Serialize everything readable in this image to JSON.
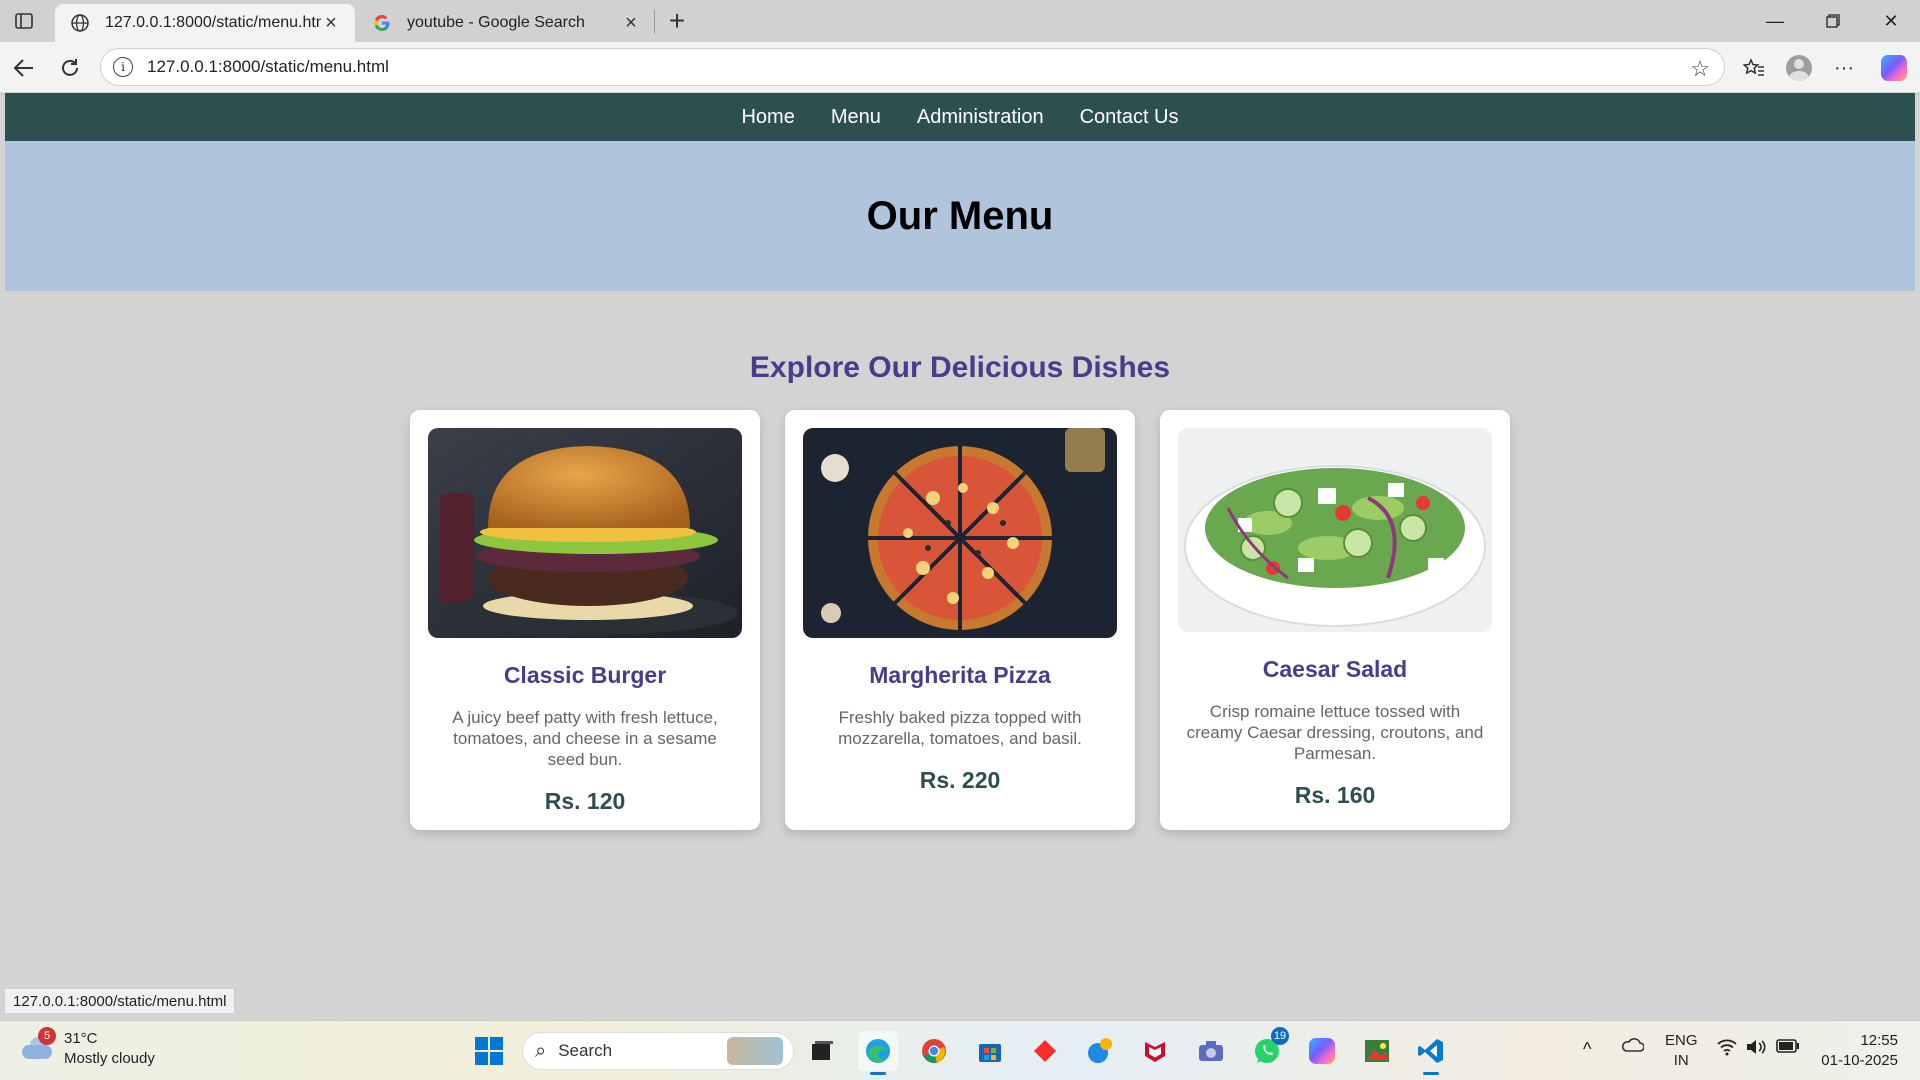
{
  "browser": {
    "tabs": [
      {
        "title": "127.0.0.1:8000/static/menu.html",
        "active": true
      },
      {
        "title": "youtube - Google Search",
        "active": false
      }
    ],
    "url": "127.0.0.1:8000/static/menu.html",
    "status_url": "127.0.0.1:8000/static/menu.html"
  },
  "nav": {
    "items": [
      "Home",
      "Menu",
      "Administration",
      "Contact Us"
    ]
  },
  "hero": {
    "title": "Our Menu"
  },
  "section": {
    "title": "Explore Our Delicious Dishes"
  },
  "dishes": [
    {
      "name": "Classic Burger",
      "description": "A juicy beef patty with fresh lettuce, tomatoes, and cheese in a sesame seed bun.",
      "price": "Rs. 120",
      "image": "burger-photo"
    },
    {
      "name": "Margherita Pizza",
      "description": "Freshly baked pizza topped with mozzarella, tomatoes, and basil.",
      "price": "Rs. 220",
      "image": "pizza-photo"
    },
    {
      "name": "Caesar Salad",
      "description": "Crisp romaine lettuce tossed with creamy Caesar dressing, croutons, and Parmesan.",
      "price": "Rs. 160",
      "image": "salad-photo"
    }
  ],
  "taskbar": {
    "weather_temp": "31°C",
    "weather_desc": "Mostly cloudy",
    "weather_badge": "5",
    "search_placeholder": "Search",
    "whatsapp_badge": "19",
    "lang_top": "ENG",
    "lang_bottom": "IN",
    "time": "12:55",
    "date": "01-10-2025"
  },
  "colors": {
    "nav_bg": "#2e4f4f",
    "hero_bg": "#b0c4de",
    "accent": "#483d8b",
    "page_bg": "#d3d3d3"
  }
}
